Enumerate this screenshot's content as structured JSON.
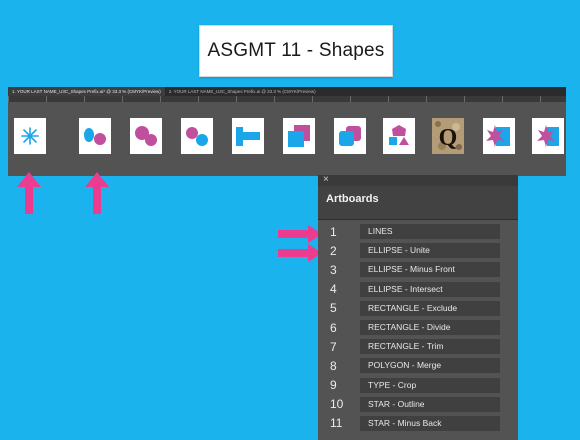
{
  "slide_title": "ASGMT 11 - Shapes",
  "document_tabs": [
    "1. YOUR LAST NAME_U3C_Shapes Prefix.ai* @ 33.3 % (CMYK/Preview)",
    "2. YOUR LAST NAME_U3C_Shapes Prefix.ai @ 33.3 % (CMYK/Preview)"
  ],
  "artboard_icons": [
    "lines",
    "ellipse-unite",
    "ellipse-minus-front",
    "ellipse-intersect",
    "rectangle-exclude",
    "rectangle-divide",
    "rectangle-trim",
    "polygon-merge",
    "type-crop",
    "star-outline",
    "star-minus-back"
  ],
  "crop_letter": "Q",
  "colors": {
    "background": "#1ab3ee",
    "cyan": "#1aa6e8",
    "magenta": "#c0509e",
    "arrow": "#ec3c8f"
  },
  "panel": {
    "close_icon": "×",
    "title": "Artboards",
    "items": [
      {
        "number": "1",
        "name": "LINES"
      },
      {
        "number": "2",
        "name": "ELLIPSE - Unite"
      },
      {
        "number": "3",
        "name": "ELLIPSE - Minus Front"
      },
      {
        "number": "4",
        "name": "ELLIPSE - Intersect"
      },
      {
        "number": "5",
        "name": "RECTANGLE - Exclude"
      },
      {
        "number": "6",
        "name": "RECTANGLE - Divide"
      },
      {
        "number": "7",
        "name": "RECTANGLE - Trim"
      },
      {
        "number": "8",
        "name": "POLYGON - Merge"
      },
      {
        "number": "9",
        "name": "TYPE - Crop"
      },
      {
        "number": "10",
        "name": "STAR - Outline"
      },
      {
        "number": "11",
        "name": "STAR - Minus Back"
      }
    ]
  }
}
